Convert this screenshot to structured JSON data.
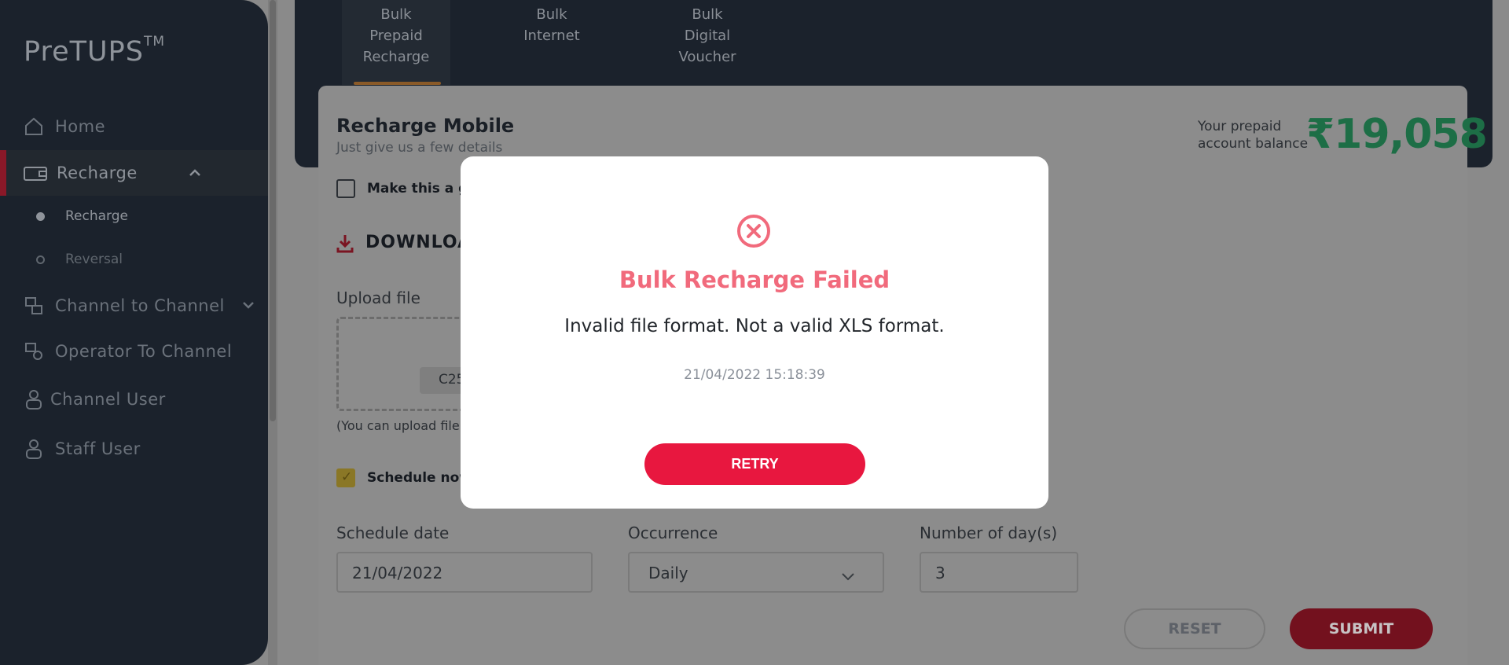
{
  "app": {
    "logo": "PreTUPS",
    "logo_sup": "TM"
  },
  "sidebar": {
    "items": [
      {
        "label": "Home",
        "icon": "home-icon"
      },
      {
        "label": "Recharge",
        "icon": "recharge-icon",
        "active": true
      },
      {
        "label": "Channel to Channel",
        "icon": "channel-icon"
      },
      {
        "label": "Operator To Channel",
        "icon": "operator-icon"
      },
      {
        "label": "Channel User",
        "icon": "user-icon"
      },
      {
        "label": "Staff User",
        "icon": "staff-icon"
      }
    ],
    "sub_items": [
      {
        "label": "Recharge",
        "selected": true
      },
      {
        "label": "Reversal",
        "selected": false
      }
    ]
  },
  "tabs": [
    {
      "label": "Bulk\nPrepaid\nRecharge",
      "active": true
    },
    {
      "label": "Bulk\nInternet",
      "active": false
    },
    {
      "label": "Bulk\nDigital\nVoucher",
      "active": false
    }
  ],
  "form": {
    "title": "Recharge Mobile",
    "subtitle": "Just give us a few details",
    "balance_label": "Your prepaid\naccount balance",
    "balance_value": "₹19,058",
    "gift_label": "Make this a gi",
    "download_label": "DOWNLOA",
    "upload_label": "Upload file",
    "file_chip": "C25",
    "upload_hint": "(You can upload file",
    "schedule_now_label": "Schedule now",
    "schedule_date_label": "Schedule date",
    "schedule_date_value": "21/04/2022",
    "occurrence_label": "Occurrence",
    "occurrence_value": "Daily",
    "days_label": "Number of day(s)",
    "days_value": "3",
    "reset_label": "RESET",
    "submit_label": "SUBMIT"
  },
  "modal": {
    "icon": "error-circle-icon",
    "title": "Bulk Recharge Failed",
    "message": "Invalid file format. Not a valid XLS format.",
    "timestamp": "21/04/2022 15:18:39",
    "retry_label": "RETRY"
  },
  "colors": {
    "error": "#e8173f",
    "balance": "#2ecc71",
    "sidebar_bg": "#1b222c"
  }
}
